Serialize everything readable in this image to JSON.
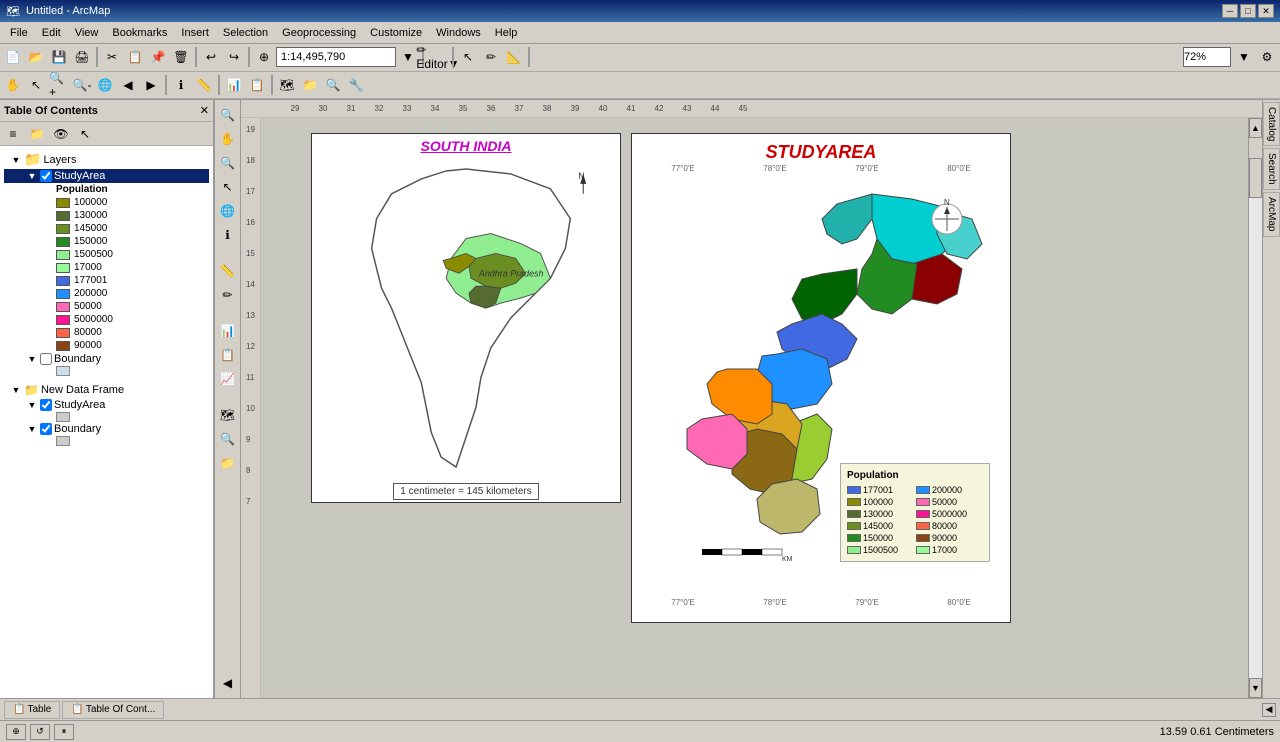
{
  "titlebar": {
    "title": "Untitled - ArcMap",
    "icon": "🗺"
  },
  "menubar": {
    "items": [
      "File",
      "Edit",
      "View",
      "Bookmarks",
      "Insert",
      "Selection",
      "Geoprocessing",
      "Customize",
      "Windows",
      "Help"
    ]
  },
  "toolbar1": {
    "scale": "1:14,495,790",
    "zoom": "72%"
  },
  "toc": {
    "title": "Table Of Contents",
    "layers_label": "Layers",
    "study_area_label": "StudyArea",
    "boundary_label_1": "Boundary",
    "new_data_frame_label": "New Data Frame",
    "study_area_2_label": "StudyArea",
    "boundary_label_2": "Boundary",
    "population_label": "Population",
    "legend": [
      {
        "value": "100000",
        "color": "#8B8B00"
      },
      {
        "value": "130000",
        "color": "#556B2F"
      },
      {
        "value": "145000",
        "color": "#6B8E23"
      },
      {
        "value": "150000",
        "color": "#228B22"
      },
      {
        "value": "1500500",
        "color": "#90EE90"
      },
      {
        "value": "17000",
        "color": "#98FB98"
      },
      {
        "value": "177001",
        "color": "#4169E1"
      },
      {
        "value": "200000",
        "color": "#1E90FF"
      },
      {
        "value": "50000",
        "color": "#FF69B4"
      },
      {
        "value": "5000000",
        "color": "#FF1493"
      },
      {
        "value": "80000",
        "color": "#FF6347"
      },
      {
        "value": "90000",
        "color": "#8B4513"
      }
    ]
  },
  "map1": {
    "title": "SOUTH INDIA",
    "region": "Andhra Pradesh"
  },
  "map2": {
    "title": "STUDYAREA"
  },
  "scale_bar": {
    "text": "1 centimeter = 145 kilometers"
  },
  "pop_legend": {
    "title": "Population",
    "items": [
      {
        "value": "177001",
        "color": "#4169E1"
      },
      {
        "value": "200000",
        "color": "#1E90FF"
      },
      {
        "value": "100000",
        "color": "#8B8B00"
      },
      {
        "value": "50000",
        "color": "#FF69B4"
      },
      {
        "value": "130000",
        "color": "#556B2F"
      },
      {
        "value": "5000000",
        "color": "#FF1493"
      },
      {
        "value": "145000",
        "color": "#6B8E23"
      },
      {
        "value": "80000",
        "color": "#FF6347"
      },
      {
        "value": "150000",
        "color": "#228B22"
      },
      {
        "value": "90000",
        "color": "#8B4513"
      },
      {
        "value": "1500500",
        "color": "#90EE90"
      },
      {
        "value": "17000",
        "color": "#98FB98"
      }
    ]
  },
  "statusbar": {
    "coords": "13.59  0.61 Centimeters"
  },
  "bottom_tabs": {
    "tab1": "Table",
    "tab2": "Table Of Cont..."
  }
}
